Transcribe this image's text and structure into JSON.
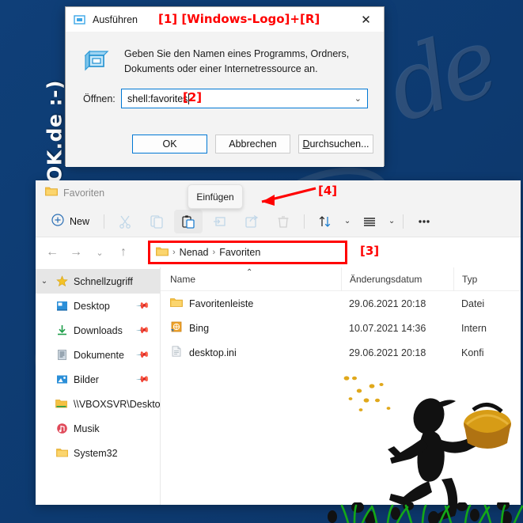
{
  "watermarks": {
    "vertical": "www.SoftwareOK.de :-)",
    "diagonal": "de",
    "big": "SoftWareOK"
  },
  "run_dialog": {
    "title": "Ausführen",
    "title_icon": "run-window-icon",
    "close_label": "✕",
    "step_marker": "[1] [Windows-Logo]+[R]",
    "description": "Geben Sie den Namen eines Programms, Ordners, Dokuments oder einer Internetressource an.",
    "open_label": "Öffnen:",
    "input_value": "shell:favorites",
    "input_placeholder": "",
    "input_step_marker": "[2]",
    "combo_arrow": "⌄",
    "buttons": {
      "ok": "OK",
      "cancel": "Abbrechen",
      "browse_prefix": "D",
      "browse_rest": "urchsuchen..."
    }
  },
  "explorer": {
    "title": "Favoriten",
    "title_icon": "folder-icon",
    "tooltip": "Einfügen",
    "tooltip_step_marker": "[4]",
    "toolbar": {
      "new_label": "New",
      "new_icon": "plus-circle-icon",
      "items": [
        {
          "name": "cut",
          "icon": "scissors-icon",
          "enabled": false
        },
        {
          "name": "copy",
          "icon": "copy-icon",
          "enabled": false
        },
        {
          "name": "paste",
          "icon": "clipboard-paste-icon",
          "enabled": true
        },
        {
          "name": "rename",
          "icon": "rename-icon",
          "enabled": false
        },
        {
          "name": "share",
          "icon": "share-icon",
          "enabled": false
        },
        {
          "name": "delete",
          "icon": "trash-icon",
          "enabled": false
        }
      ],
      "sort_icon": "sort-arrows-icon",
      "view_icon": "view-list-icon",
      "more_icon": "ellipsis-icon",
      "chevron": "⌄"
    },
    "nav": {
      "back": "←",
      "forward": "→",
      "recent": "⌄",
      "up": "↑"
    },
    "breadcrumb": {
      "folder_icon": "folder-icon",
      "separator": "›",
      "parts": [
        "Nenad",
        "Favoriten"
      ],
      "step_marker": "[3]"
    },
    "sidebar": {
      "items": [
        {
          "label": "Schnellzugriff",
          "icon": "star-icon",
          "chevron": "⌄",
          "header": true,
          "pinned": false
        },
        {
          "label": "Desktop",
          "icon": "desktop-icon",
          "header": false,
          "pinned": true
        },
        {
          "label": "Downloads",
          "icon": "download-icon",
          "header": false,
          "pinned": true
        },
        {
          "label": "Dokumente",
          "icon": "document-icon",
          "header": false,
          "pinned": true
        },
        {
          "label": "Bilder",
          "icon": "pictures-icon",
          "header": false,
          "pinned": true
        },
        {
          "label": "\\\\VBOXSVR\\Deskto",
          "icon": "network-folder-icon",
          "header": false,
          "pinned": false
        },
        {
          "label": "Musik",
          "icon": "music-icon",
          "header": false,
          "pinned": false
        },
        {
          "label": "System32",
          "icon": "folder-icon",
          "header": false,
          "pinned": false
        }
      ]
    },
    "columns": [
      {
        "key": "name",
        "label": "Name",
        "sorted": true,
        "sort_caret": "⌃"
      },
      {
        "key": "date",
        "label": "Änderungsdatum"
      },
      {
        "key": "type",
        "label": "Typ"
      }
    ],
    "rows": [
      {
        "name": "Favoritenleiste",
        "icon": "folder-icon",
        "date": "29.06.2021 20:18",
        "type": "Datei"
      },
      {
        "name": "Bing",
        "icon": "internet-shortcut-icon",
        "date": "10.07.2021 14:36",
        "type": "Intern"
      },
      {
        "name": "desktop.ini",
        "icon": "ini-file-icon",
        "date": "29.06.2021 20:18",
        "type": "Konfi"
      }
    ]
  },
  "colors": {
    "background": "#0e3c73",
    "accent": "#0078d4",
    "marker_red": "#ff0000",
    "toolbar_bg": "#f3f3f3",
    "folder_yellow": "#f5c142",
    "grass_green": "#14a818",
    "basket_gold": "#d79c16"
  },
  "decoration": {
    "figure": "easter-runner-figure",
    "basket": "easter-basket",
    "confetti": "confetti-dots",
    "grass": "grass-and-eggs"
  }
}
